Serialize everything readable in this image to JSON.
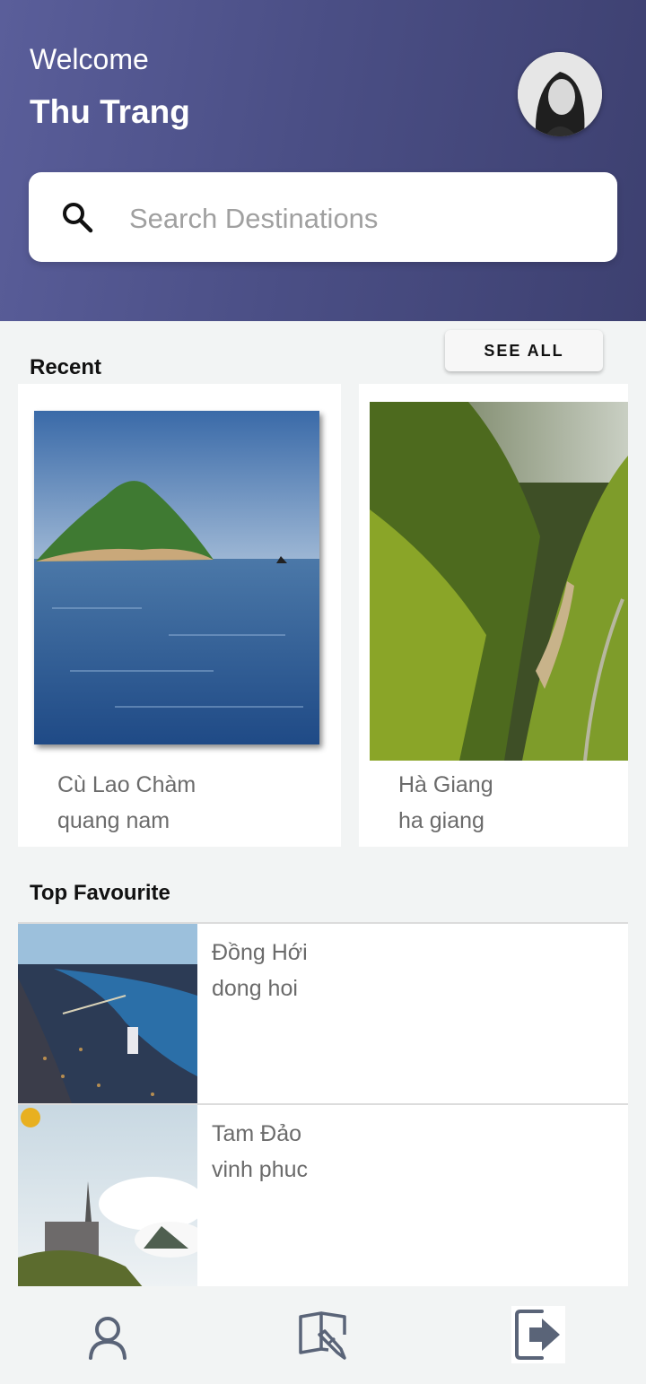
{
  "header": {
    "welcome": "Welcome",
    "username": "Thu Trang"
  },
  "search": {
    "placeholder": "Search Destinations"
  },
  "recent": {
    "title": "Recent",
    "see_all": "SEE ALL",
    "items": [
      {
        "name": "Cù Lao Chàm",
        "province": "quang nam"
      },
      {
        "name": "Hà Giang",
        "province": "ha giang"
      }
    ]
  },
  "favourite": {
    "title": "Top Favourite",
    "items": [
      {
        "name": "Đồng Hới",
        "province": "dong hoi"
      },
      {
        "name": "Tam Đảo",
        "province": "vinh phuc"
      }
    ]
  },
  "nav": {
    "items": [
      "profile-icon",
      "edit-notebook-icon",
      "logout-icon"
    ]
  },
  "colors": {
    "header_start": "#5a5e9a",
    "header_end": "#3d4070",
    "icon": "#5a6478"
  }
}
